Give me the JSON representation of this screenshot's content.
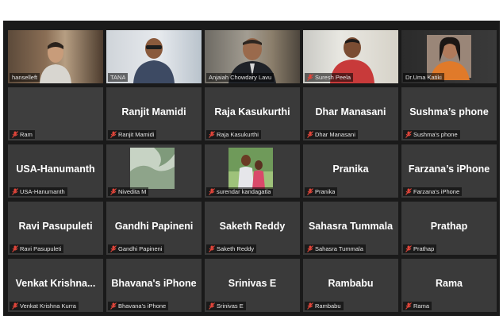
{
  "participants": [
    {
      "display": "",
      "name": "hanselleft",
      "video": true
    },
    {
      "display": "",
      "name": "TANA",
      "video": true
    },
    {
      "display": "",
      "name": "Anjaiah Chowdary Lavu",
      "video": true
    },
    {
      "display": "",
      "name": "Suresh Peela",
      "video": true
    },
    {
      "display": "",
      "name": "Dr.Uma Katiki",
      "video": true,
      "active": true
    },
    {
      "display": "",
      "name": "Ram"
    },
    {
      "display": "Ranjit Mamidi",
      "name": "Ranjit Mamidi"
    },
    {
      "display": "Raja Kasukurthi",
      "name": "Raja Kasukurthi"
    },
    {
      "display": "Dhar Manasani",
      "name": "Dhar Manasani"
    },
    {
      "display": "Sushma’s phone",
      "name": "Sushma's phone"
    },
    {
      "display": "USA-Hanumanth",
      "name": "USA-Hanumanth"
    },
    {
      "display": "",
      "name": "Nivedita M",
      "picture": true
    },
    {
      "display": "",
      "name": "surendar kandagatla",
      "picture": true
    },
    {
      "display": "Pranika",
      "name": "Pranika"
    },
    {
      "display": "Farzana’s iPhone",
      "name": "Farzana's iPhone"
    },
    {
      "display": "Ravi Pasupuleti",
      "name": "Ravi Pasupuleti"
    },
    {
      "display": "Gandhi Papineni",
      "name": "Gandhi Papineni"
    },
    {
      "display": "Saketh Reddy",
      "name": "Saketh Reddy"
    },
    {
      "display": "Sahasra Tummala",
      "name": "Sahasra Tummala"
    },
    {
      "display": "Prathap",
      "name": "Prathap"
    },
    {
      "display": "Venkat  Krishna...",
      "name": "Venkat Krishna Kurra"
    },
    {
      "display": "Bhavana's iPhone",
      "name": "Bhavana's iPhone"
    },
    {
      "display": "Srinivas E",
      "name": "Srinivas E"
    },
    {
      "display": "Rambabu",
      "name": "Rambabu"
    },
    {
      "display": "Rama",
      "name": "Rama"
    }
  ],
  "colors": {
    "tile": "#3a3a3a",
    "background": "#1a1a1a",
    "active_border": "#b9e26b",
    "muted_mic": "#e0453a"
  },
  "icons": {
    "mic": "mic-muted-icon"
  }
}
